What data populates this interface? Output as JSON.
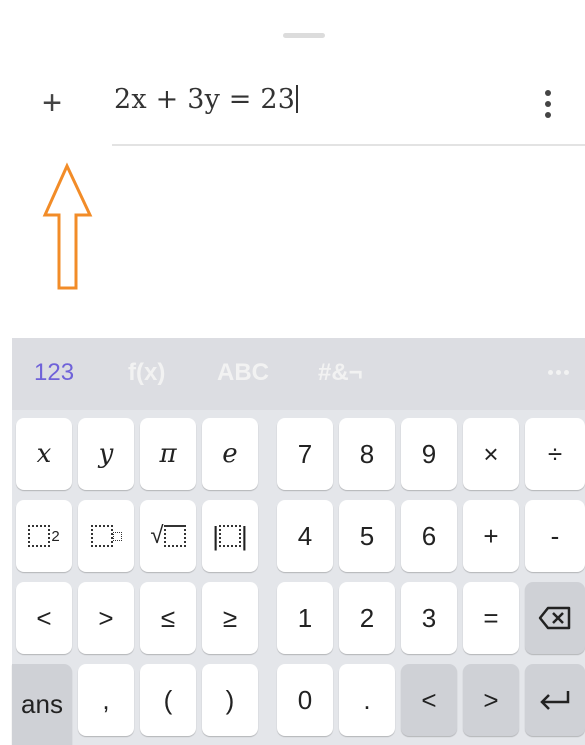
{
  "input": {
    "expression": "2x + 3y = 23",
    "add_icon": "+",
    "menu_icon": "more-vert-icon"
  },
  "tabs": [
    {
      "label": "123",
      "active": true
    },
    {
      "label": "f(x)",
      "active": false
    },
    {
      "label": "ABC",
      "active": false
    },
    {
      "label": "#&¬",
      "active": false
    }
  ],
  "keys": {
    "row1": [
      "x",
      "y",
      "π",
      "e",
      "7",
      "8",
      "9",
      "×",
      "÷"
    ],
    "row2": [
      "□²",
      "□□",
      "√□",
      "|□|",
      "4",
      "5",
      "6",
      "+",
      "-"
    ],
    "row3": [
      "<",
      ">",
      "≤",
      "≥",
      "1",
      "2",
      "3",
      "=",
      "⌫"
    ],
    "row4": [
      "ans",
      ",",
      "(",
      ")",
      "0",
      ".",
      "<",
      ">",
      "↵"
    ]
  },
  "colors": {
    "active_tab": "#6f62d9",
    "annotation_arrow": "#f28c28"
  }
}
